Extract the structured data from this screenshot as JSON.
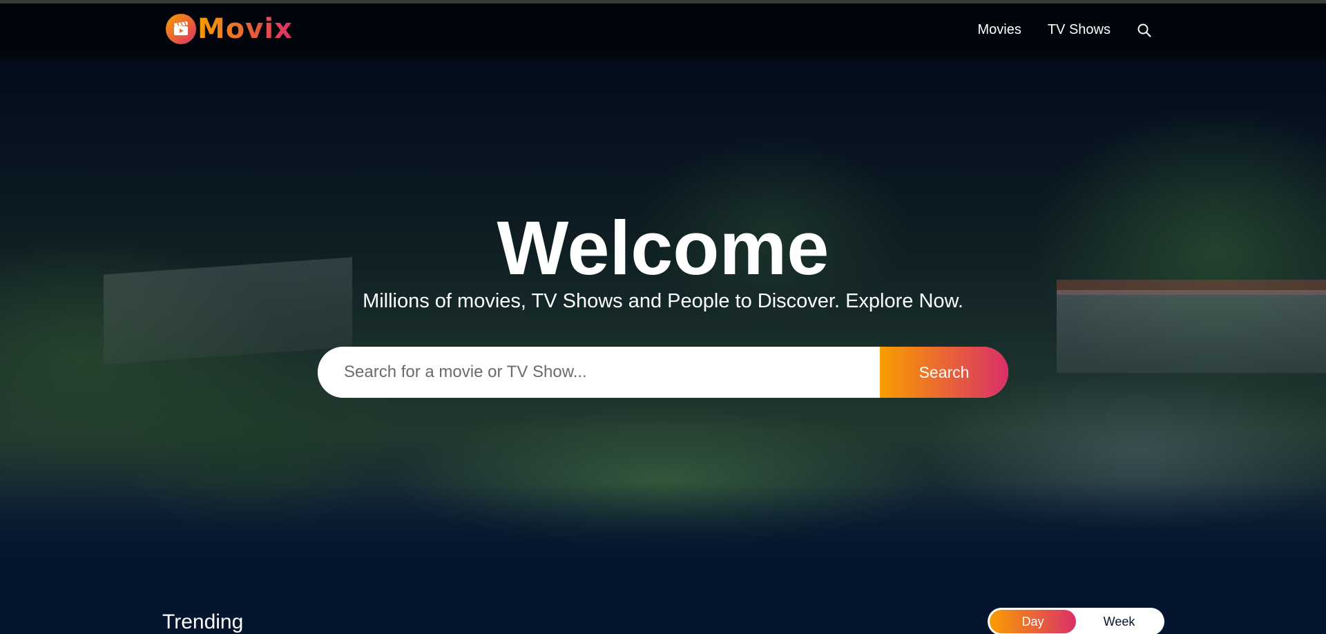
{
  "header": {
    "logo_text": "Movix",
    "nav": [
      {
        "label": "Movies"
      },
      {
        "label": "TV Shows"
      }
    ],
    "search_icon": "search-icon"
  },
  "hero": {
    "title": "Welcome",
    "subtitle": "Millions of movies, TV Shows and People to Discover. Explore Now.",
    "search": {
      "placeholder": "Search for a movie or TV Show...",
      "value": "",
      "button_label": "Search"
    }
  },
  "trending": {
    "title": "Trending",
    "tabs": [
      {
        "label": "Day",
        "active": true
      },
      {
        "label": "Week",
        "active": false
      }
    ]
  },
  "colors": {
    "accent_start": "#f89e00",
    "accent_end": "#da2f68",
    "background": "#04152d"
  }
}
